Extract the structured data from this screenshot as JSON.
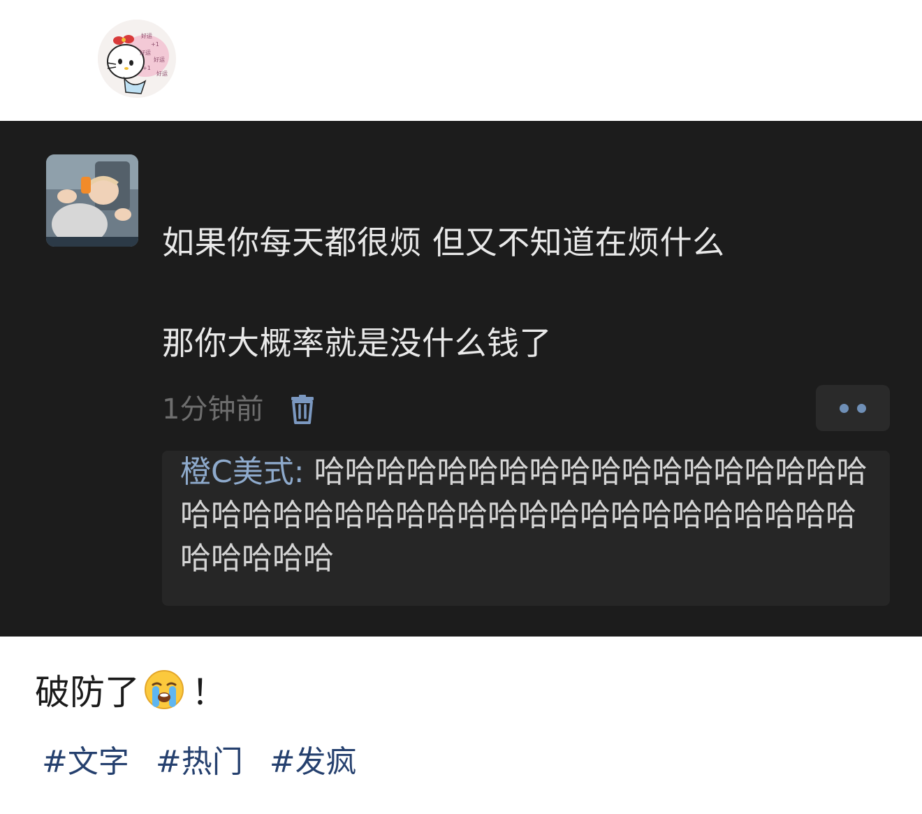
{
  "post_author": {
    "avatar_icon": "hello-kitty-avatar-icon"
  },
  "comment": {
    "avatar_icon": "baby-photo-avatar-icon",
    "line1": "如果你每天都很烦 但又不知道在烦什么",
    "line2": "那你大概率就是没什么钱了",
    "time": "1分钟前",
    "delete_icon": "trash-icon",
    "more_icon": "more-dots-icon",
    "reply": {
      "author": "橙C美式:",
      "text": " 哈哈哈哈哈哈哈哈哈哈哈哈哈哈哈哈哈哈哈哈哈哈哈哈哈哈哈哈哈哈哈哈哈哈哈哈哈哈哈哈哈哈哈哈哈"
    }
  },
  "post": {
    "text": "破防了",
    "emoji": "loudly-crying-face-icon",
    "suffix": "！"
  },
  "tags": [
    "#文字",
    "#热门",
    "#发疯"
  ],
  "colors": {
    "dark_bg": "#1c1c1c",
    "reply_bg": "#262626",
    "reply_author": "#8eaacc",
    "tag": "#25406e"
  }
}
